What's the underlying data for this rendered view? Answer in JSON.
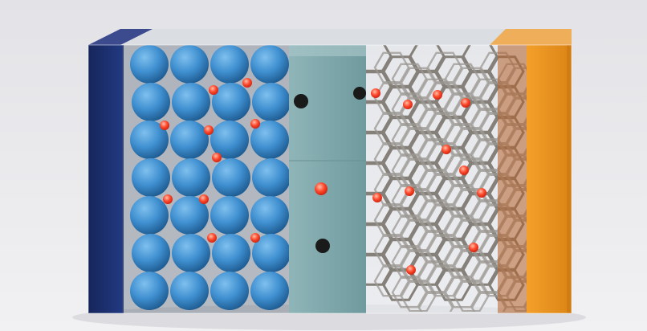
{
  "scene": {
    "subject": "battery-cell-cross-section",
    "components": [
      {
        "id": "current-collector-left",
        "color": "#1c2f6e"
      },
      {
        "id": "electrode-spheres",
        "color": "#3f8fd0"
      },
      {
        "id": "separator",
        "color": "#7fa8ab"
      },
      {
        "id": "electrode-honeycomb",
        "color": "#8e8a86"
      },
      {
        "id": "current-collector-right",
        "color": "#e99a24"
      }
    ],
    "ion_color": "#ff4a2e",
    "background_color": "#e9e9ec",
    "sphere_grid": {
      "columns": 4,
      "rows": 7
    }
  }
}
